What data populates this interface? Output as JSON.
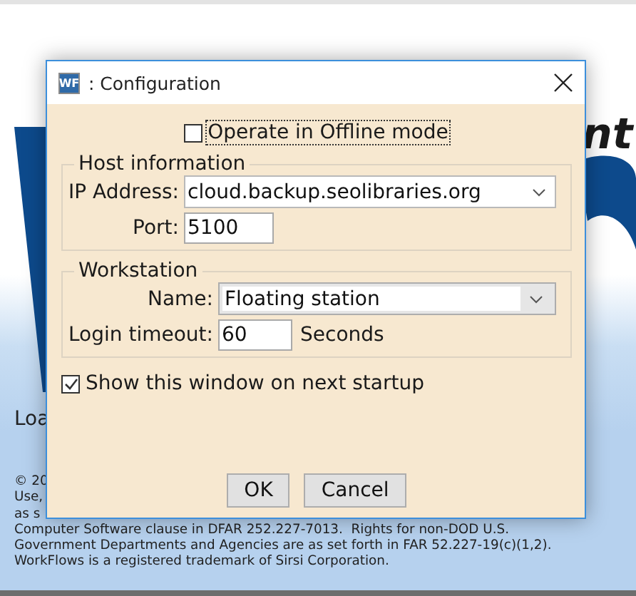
{
  "background_window": {
    "heading_fragment": "nt",
    "status_text": "Loa",
    "copyright_lines": [
      "© 20",
      "Use,",
      "as s",
      "Computer Software clause in DFAR 252.227-7013.  Rights for non-DOD U.S.",
      "Government Departments and Agencies are as set forth in FAR 52.227-19(c)(1,2).",
      "WorkFlows is a registered trademark of Sirsi Corporation."
    ]
  },
  "dialog": {
    "icon_text": "WF",
    "title": ": Configuration",
    "offline_mode": {
      "label": "Operate in Offline mode",
      "checked": false,
      "focused": true
    },
    "groups": [
      {
        "legend": "Host information",
        "fields": [
          {
            "kind": "combo",
            "label": "IP Address:",
            "value": "cloud.backup.seolibraries.org"
          },
          {
            "kind": "text",
            "label": "Port:",
            "value": "5100"
          }
        ]
      },
      {
        "legend": "Workstation",
        "fields": [
          {
            "kind": "dropdown",
            "label": "Name:",
            "value": "Floating station"
          },
          {
            "kind": "text",
            "label": "Login timeout:",
            "value": "60",
            "suffix": "Seconds"
          }
        ]
      }
    ],
    "show_on_startup": {
      "label": "Show this window on next startup",
      "checked": true,
      "focused": false
    },
    "buttons": [
      "OK",
      "Cancel"
    ]
  }
}
